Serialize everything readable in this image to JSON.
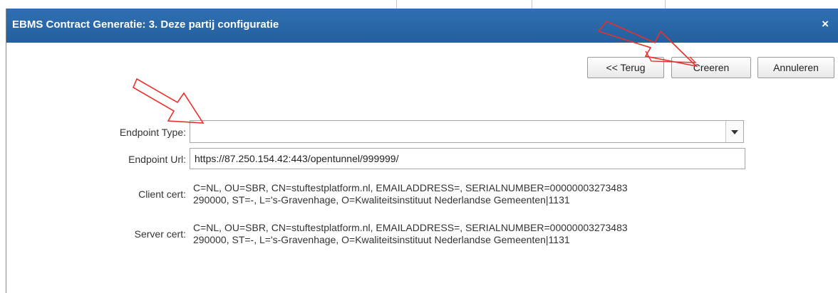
{
  "dialog": {
    "title": "EBMS Contract Generatie: 3. Deze partij configuratie",
    "close_glyph": "×"
  },
  "toolbar": {
    "back_label": "<< Terug",
    "create_label": "Creeren",
    "cancel_label": "Annuleren"
  },
  "form": {
    "endpoint_type": {
      "label": "Endpoint Type:",
      "value": ""
    },
    "endpoint_url": {
      "label": "Endpoint Url:",
      "value": "https://87.250.154.42:443/opentunnel/999999/"
    },
    "client_cert": {
      "label": "Client cert:",
      "lines": [
        "C=NL, OU=SBR, CN=stuftestplatform.nl, EMAILADDRESS=, SERIALNUMBER=00000003273483",
        "290000, ST=-, L='s-Gravenhage, O=Kwaliteitsinstituut Nederlandse Gemeenten|1131"
      ]
    },
    "server_cert": {
      "label": "Server cert:",
      "lines": [
        "C=NL, OU=SBR, CN=stuftestplatform.nl, EMAILADDRESS=, SERIALNUMBER=00000003273483",
        "290000, ST=-, L='s-Gravenhage, O=Kwaliteitsinstituut Nederlandse Gemeenten|1131"
      ]
    }
  },
  "icons": {
    "close": "close-icon",
    "dropdown": "chevron-down-icon",
    "annotation": "red-arrow-annotation"
  },
  "colors": {
    "titlebar": "#2a67a8",
    "annotation_red": "#e8302a"
  }
}
